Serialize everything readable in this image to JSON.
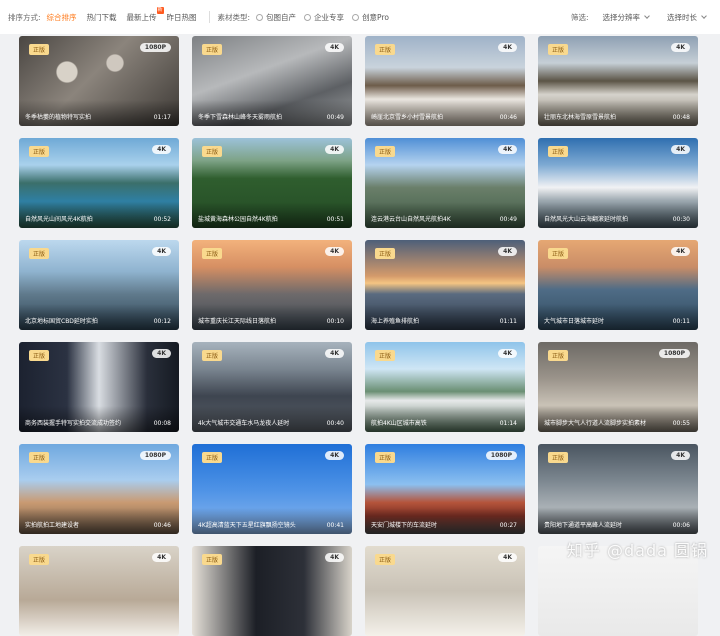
{
  "filter": {
    "sort_label": "排序方式:",
    "sort_options": [
      {
        "label": "综合排序",
        "active": true
      },
      {
        "label": "热门下载",
        "active": false
      },
      {
        "label": "最新上传",
        "active": false,
        "badge": "新"
      },
      {
        "label": "昨日热图",
        "active": false
      }
    ],
    "type_label": "素材类型:",
    "type_options": [
      "包图自产",
      "企业专享",
      "创意Pro"
    ],
    "filter_label": "筛选:",
    "resolution_dropdown": "选择分辨率",
    "duration_dropdown": "选择时长"
  },
  "accent_color": "#ff7a1a",
  "videos": [
    {
      "tag": "正版",
      "res": "1080P",
      "title": "冬季枯萎的植物特写实拍",
      "duration": "01:17"
    },
    {
      "tag": "正版",
      "res": "4K",
      "title": "冬季下雪森林山峰冬天雾雨航拍",
      "duration": "00:49"
    },
    {
      "tag": "正版",
      "res": "4K",
      "title": "崎崖北京雪乡小村雪景航拍",
      "duration": "00:46"
    },
    {
      "tag": "正版",
      "res": "4K",
      "title": "壮丽东北林海雪原雪景航拍",
      "duration": "00:48"
    },
    {
      "tag": "正版",
      "res": "4K",
      "title": "自然风光山间风光4K航拍",
      "duration": "00:52"
    },
    {
      "tag": "正版",
      "res": "4K",
      "title": "盐城黄海森林公园自然4K航拍",
      "duration": "00:51"
    },
    {
      "tag": "正版",
      "res": "4K",
      "title": "连云港云台山自然风光航拍4K",
      "duration": "00:49"
    },
    {
      "tag": "正版",
      "res": "4K",
      "title": "自然风光大山云海翻滚延时航拍",
      "duration": "00:30"
    },
    {
      "tag": "正版",
      "res": "4K",
      "title": "北京地标国贸CBD延时实拍",
      "duration": "00:12"
    },
    {
      "tag": "正版",
      "res": "4K",
      "title": "城市重庆长江天际线日落航拍",
      "duration": "00:10"
    },
    {
      "tag": "正版",
      "res": "4K",
      "title": "海上养殖鱼排航拍",
      "duration": "01:11"
    },
    {
      "tag": "正版",
      "res": "4K",
      "title": "大气城市日落城市延时",
      "duration": "00:11"
    },
    {
      "tag": "正版",
      "res": "4K",
      "title": "商务西装握手特写实拍交流成功签约",
      "duration": "00:08"
    },
    {
      "tag": "正版",
      "res": "4K",
      "title": "4k大气城市交通车水马龙夜人延时",
      "duration": "00:40"
    },
    {
      "tag": "正版",
      "res": "4K",
      "title": "航拍4K山区城市高铁",
      "duration": "01:14"
    },
    {
      "tag": "正版",
      "res": "1080P",
      "title": "城市脚步大气人行道人流脚步实拍素材",
      "duration": "00:55"
    },
    {
      "tag": "正版",
      "res": "1080P",
      "title": "实拍航拍工地建设者",
      "duration": "00:46"
    },
    {
      "tag": "正版",
      "res": "4K",
      "title": "4K超高清蓝天下五星红旗飘扬空镜头",
      "duration": "00:41"
    },
    {
      "tag": "正版",
      "res": "1080P",
      "title": "天安门城楼下的车流延时",
      "duration": "00:27"
    },
    {
      "tag": "正版",
      "res": "4K",
      "title": "贵阳地下通道平高峰人流延时",
      "duration": "00:06"
    },
    {
      "tag": "正版",
      "res": "4K",
      "title": "",
      "duration": ""
    },
    {
      "tag": "正版",
      "res": "4K",
      "title": "",
      "duration": ""
    },
    {
      "tag": "正版",
      "res": "4K",
      "title": "",
      "duration": ""
    },
    {
      "tag": "",
      "res": "",
      "title": "",
      "duration": ""
    }
  ],
  "watermark": "知乎 @dada 圆锅"
}
